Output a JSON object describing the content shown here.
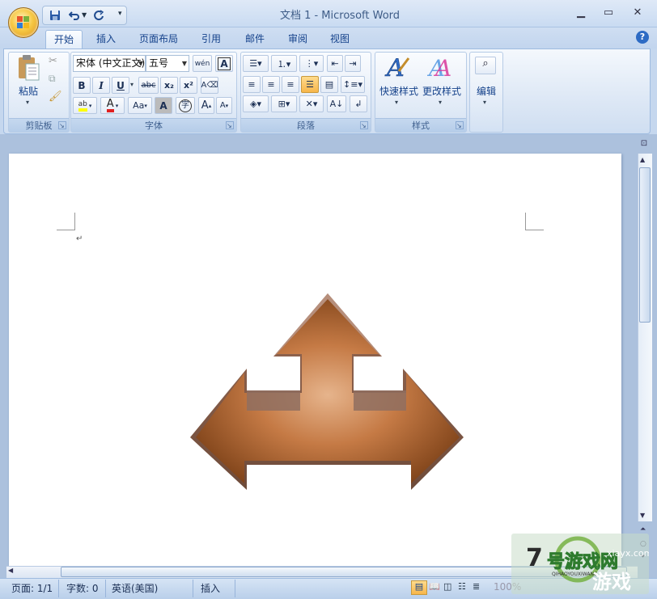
{
  "window": {
    "title": "文档 1 - Microsoft Word",
    "min_icon": "minimize-icon",
    "max_icon": "maximize-icon",
    "close_icon": "close-icon"
  },
  "quick_access": {
    "save_icon": "save-icon",
    "undo_icon": "undo-icon",
    "redo_icon": "redo-icon",
    "customize_icon": "customize-dropdown-icon"
  },
  "tabs": [
    {
      "label": "开始",
      "active": true
    },
    {
      "label": "插入"
    },
    {
      "label": "页面布局"
    },
    {
      "label": "引用"
    },
    {
      "label": "邮件"
    },
    {
      "label": "审阅"
    },
    {
      "label": "视图"
    }
  ],
  "help": "?",
  "ribbon": {
    "clipboard": {
      "label": "剪贴板",
      "paste": "粘贴"
    },
    "font": {
      "label": "字体",
      "font_name": "宋体 (中文正文)",
      "font_size": "五号",
      "wen": "wén",
      "A_box": "A",
      "bold": "B",
      "italic": "I",
      "underline": "U",
      "strike": "abc",
      "subscript": "x₂",
      "superscript": "x²",
      "aa": "Aa",
      "char_shade": "A",
      "enclose": "字",
      "grow": "A",
      "shrink": "A"
    },
    "paragraph": {
      "label": "段落"
    },
    "styles": {
      "label": "样式",
      "quick": "快速样式",
      "change": "更改样式"
    },
    "editing": {
      "label": "编辑"
    }
  },
  "status": {
    "page": "页面: 1/1",
    "words": "字数: 0",
    "language": "英语(美国)",
    "insert": "插入",
    "zoom": "100%"
  },
  "watermark": {
    "brand_text": "7号游戏网",
    "sub_text": "QIHAOYOUXIWANG",
    "url": "xiayx.com",
    "sub2": "游戏"
  },
  "colors": {
    "highlight": "#ffff00",
    "font_color": "#e02020",
    "arrow_dark": "#8a4a1e",
    "arrow_light": "#e8b68e"
  }
}
